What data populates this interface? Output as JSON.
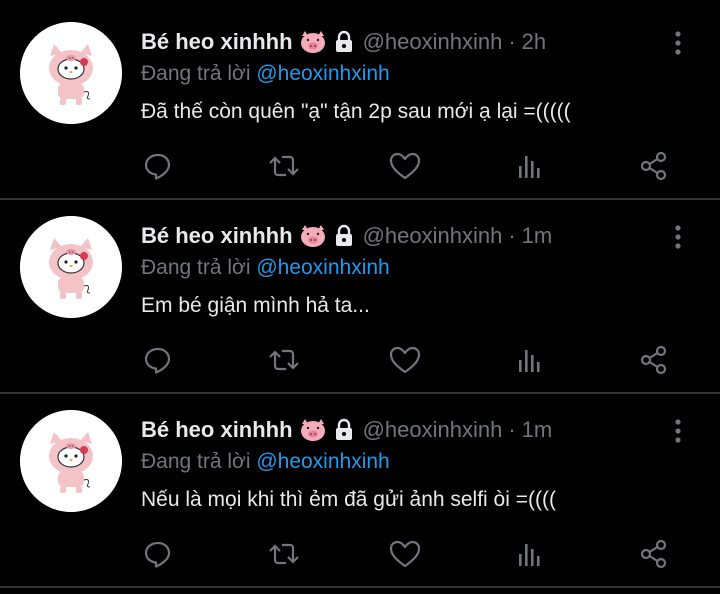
{
  "tweets": [
    {
      "display_name": "Bé heo xinhhh",
      "handle": "@heoxinhxinh",
      "separator": "·",
      "time": "2h",
      "replying_prefix": "Đang trả lời",
      "replying_to": "@heoxinhxinh",
      "text": "Đã thế còn quên \"ạ\" tận 2p sau mới ạ lại =((((("
    },
    {
      "display_name": "Bé heo xinhhh",
      "handle": "@heoxinhxinh",
      "separator": "·",
      "time": "1m",
      "replying_prefix": "Đang trả lời",
      "replying_to": "@heoxinhxinh",
      "text": "Em bé giận mình hả ta..."
    },
    {
      "display_name": "Bé heo xinhhh",
      "handle": "@heoxinhxinh",
      "separator": "·",
      "time": "1m",
      "replying_prefix": "Đang trả lời",
      "replying_to": "@heoxinhxinh",
      "text": "Nếu là mọi khi thì ẻm đã gửi ảnh selfi òi =(((("
    }
  ],
  "icons": {
    "name_emoji": "pig-face-icon",
    "protected": "lock-icon",
    "more": "more-vertical-icon",
    "reply": "reply-icon",
    "retweet": "retweet-icon",
    "like": "heart-icon",
    "views": "analytics-icon",
    "share": "share-icon"
  },
  "colors": {
    "background": "#000000",
    "text": "#e7e9ea",
    "muted": "#71767b",
    "link": "#1d9bf0",
    "divider": "#2f3336"
  }
}
